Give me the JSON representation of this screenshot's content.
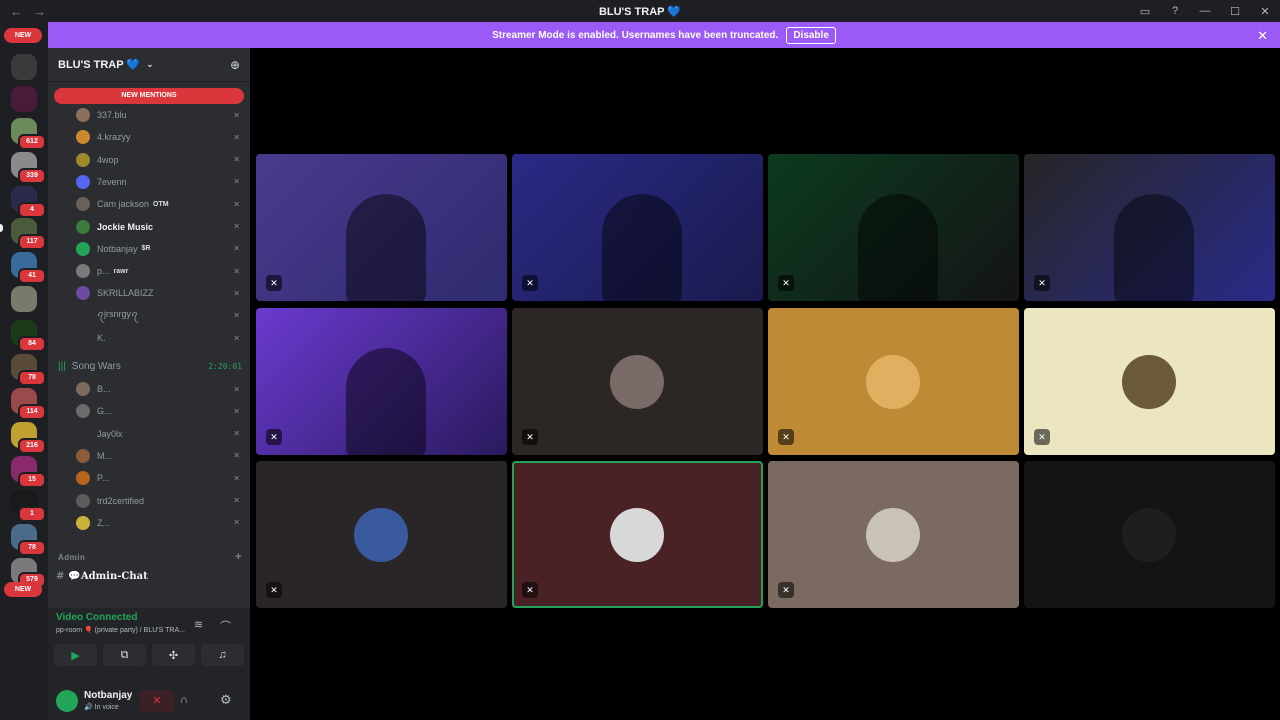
{
  "titlebar": {
    "title": "BLU'S TRAP 💙",
    "back": "←",
    "forward": "→",
    "inbox": "▭",
    "help": "?",
    "minimize": "—",
    "maximize": "☐",
    "close": "✕"
  },
  "banner": {
    "text": "Streamer Mode is enabled. Usernames have been truncated.",
    "button": "Disable",
    "close": "✕"
  },
  "rail": {
    "new_top": "NEW",
    "new_bottom": "NEW",
    "badges": [
      "612",
      "339",
      "4",
      "117",
      "41",
      "84",
      "78",
      "114",
      "216",
      "15",
      "1",
      "78",
      "579"
    ]
  },
  "server": {
    "name": "BLU'S TRAP 💙",
    "chevron": "⌄",
    "add_user_icon": "⊕"
  },
  "new_mentions": "NEW MENTIONS",
  "voice_users_top": [
    {
      "name": "337.blu",
      "color": "#8a6f5c",
      "bright": false
    },
    {
      "name": "4.krazyy",
      "color": "#c98a2e",
      "bright": false
    },
    {
      "name": "4wop",
      "color": "#9c8a2b",
      "bright": false
    },
    {
      "name": "7evenn",
      "color": "#5865f2",
      "bright": false
    },
    {
      "name": "Cam jackson",
      "tag": "OTM",
      "color": "#6a5f59",
      "bright": false
    },
    {
      "name": "Jockie Music",
      "color": "#3b7a3d",
      "bright": true
    },
    {
      "name": "Notbanjay",
      "tag": "$R",
      "color": "#23a559",
      "bright": false
    },
    {
      "name": "p...",
      "tag": "rawr",
      "color": "#7a7a7a",
      "bright": false
    },
    {
      "name": "SKRILLABIZZ",
      "color": "#6b4aa0",
      "bright": false
    },
    {
      "name": "ꪖjrsnrgyꪖ",
      "color": "#2b2d31",
      "bright": false
    },
    {
      "name": "K.",
      "color": "#2b2d31",
      "bright": false
    }
  ],
  "song_wars": {
    "name": "Song Wars",
    "time": "2:20:01",
    "wave_icon": "|||"
  },
  "voice_users_bottom": [
    {
      "name": "B...",
      "color": "#7d6b5c"
    },
    {
      "name": "G...",
      "color": "#6b6b6b"
    },
    {
      "name": "Jay0lx",
      "color": "#2b2d31"
    },
    {
      "name": "M...",
      "color": "#8a5c3b"
    },
    {
      "name": "P...",
      "color": "#b5651d"
    },
    {
      "name": "trd2certified",
      "color": "#5c5c5c"
    },
    {
      "name": "Z...",
      "color": "#c9b23a"
    }
  ],
  "admin": {
    "category": "Admin",
    "plus": "+",
    "channel": "💬Admin-Chat"
  },
  "voice_panel": {
    "status": "Video Connected",
    "room": "pp-room 🎈 (private party) / BLU'S TRA...",
    "signal_icon": "◔",
    "noise_icon": "≋",
    "disconnect_icon": "⌒",
    "actions": {
      "camera": "▶",
      "screen": "⧉",
      "activities": "✣",
      "soundboard": "♫"
    }
  },
  "user": {
    "name": "Notbanjay",
    "status": "🔊 In voice",
    "mute_icon": "✕",
    "headphone_icon": "∩",
    "gear_icon": "⚙"
  },
  "tiles": [
    {
      "type": "video",
      "colors": [
        "#4a3a8e",
        "#2e2b6e"
      ]
    },
    {
      "type": "video",
      "colors": [
        "#2a2a86",
        "#1a1a4e"
      ]
    },
    {
      "type": "video",
      "colors": [
        "#0c3a20",
        "#141414"
      ]
    },
    {
      "type": "video",
      "colors": [
        "#262626",
        "#2a2a8a"
      ]
    },
    {
      "type": "video",
      "colors": [
        "#6a3ad0",
        "#2a1a5e"
      ]
    },
    {
      "type": "avatar",
      "bg": "#2c2624",
      "avatar": "#7a6a68"
    },
    {
      "type": "avatar",
      "bg": "#bf8a35",
      "avatar": "#e0b060"
    },
    {
      "type": "avatar",
      "bg": "#ebe6bf",
      "avatar": "#6a5a3a"
    },
    {
      "type": "avatar",
      "bg": "#2a2628",
      "avatar": "#3a5aa0"
    },
    {
      "type": "avatar",
      "bg": "#4a2226",
      "avatar": "#d8d8d8",
      "speaking": true
    },
    {
      "type": "avatar",
      "bg": "#7a6a60",
      "avatar": "#c9c2b8"
    },
    {
      "type": "avatar",
      "bg": "#141414",
      "avatar": "#1e1e1e"
    }
  ],
  "mic_off_icon": "✕"
}
